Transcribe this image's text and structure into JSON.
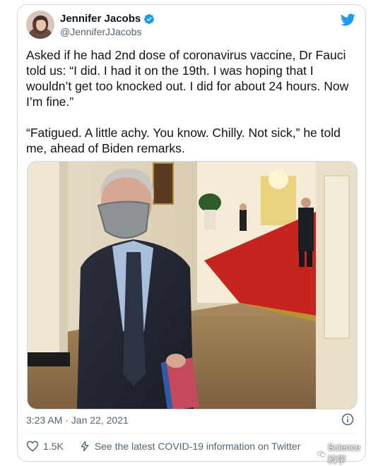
{
  "author": {
    "display_name": "Jennifer Jacobs",
    "handle": "@JenniferJJacobs",
    "verified_icon": "verified-badge-icon",
    "avatar_icon": "user-avatar"
  },
  "brand": {
    "logo_icon": "twitter-bird-icon",
    "color": "#1d9bf0"
  },
  "tweet": {
    "paragraph1": "Asked if he had 2nd dose of coronavirus vaccine, Dr Fauci told us: “I did. I had it on the 19th. I was hoping that I wouldn’t get too knocked out. I did for about 24 hours. Now I’m fine.”",
    "paragraph2": "“Fatigued. A little achy. You know. Chilly. Not sick,” he told me, ahead of Biden remarks.",
    "timestamp": "3:23 AM · Jan 22, 2021",
    "info_icon": "info-icon"
  },
  "actions": {
    "like_count": "1.5K",
    "like_icon": "heart-icon",
    "covid_text": "See the latest COVID-19 information on Twitter",
    "covid_icon": "lightning-icon"
  },
  "watermark": {
    "text": "Science科学",
    "icon": "wechat-icon"
  }
}
